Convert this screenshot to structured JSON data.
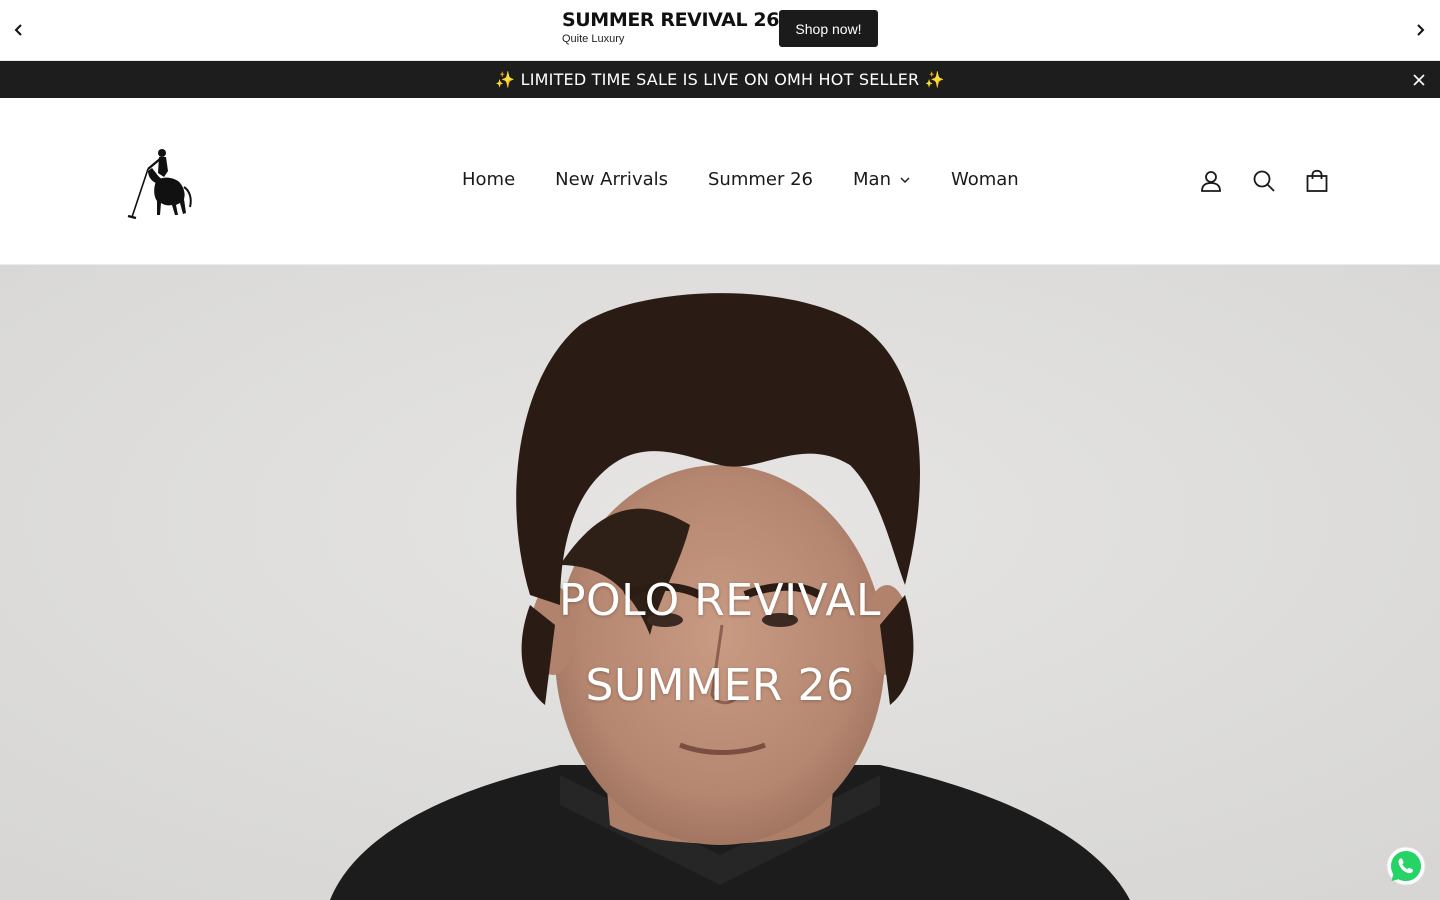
{
  "promo": {
    "headline": "SUMMER REVIVAL 26",
    "subline": "Quite Luxury",
    "button_label": "Shop now!",
    "prev_icon": "chevron-left-icon",
    "next_icon": "chevron-right-icon"
  },
  "announcement": {
    "spark_left": "✨",
    "text": " LIMITED TIME SALE IS LIVE ON OMH HOT SELLER ",
    "spark_right": "✨",
    "close_icon": "close-icon",
    "background": "#1d1d1d"
  },
  "header": {
    "logo": "polo-rider-logo",
    "nav": [
      {
        "label": "Home"
      },
      {
        "label": "New Arrivals"
      },
      {
        "label": "Summer 26"
      },
      {
        "label": "Man",
        "has_dropdown": true
      },
      {
        "label": "Woman"
      }
    ],
    "icons": [
      "account-icon",
      "search-icon",
      "cart-icon"
    ]
  },
  "hero": {
    "title": "POLO REVIVAL",
    "subtitle": "SUMMER 26",
    "text_color": "#ffffff"
  },
  "whatsapp": {
    "icon": "whatsapp-icon",
    "color": "#25d366"
  }
}
